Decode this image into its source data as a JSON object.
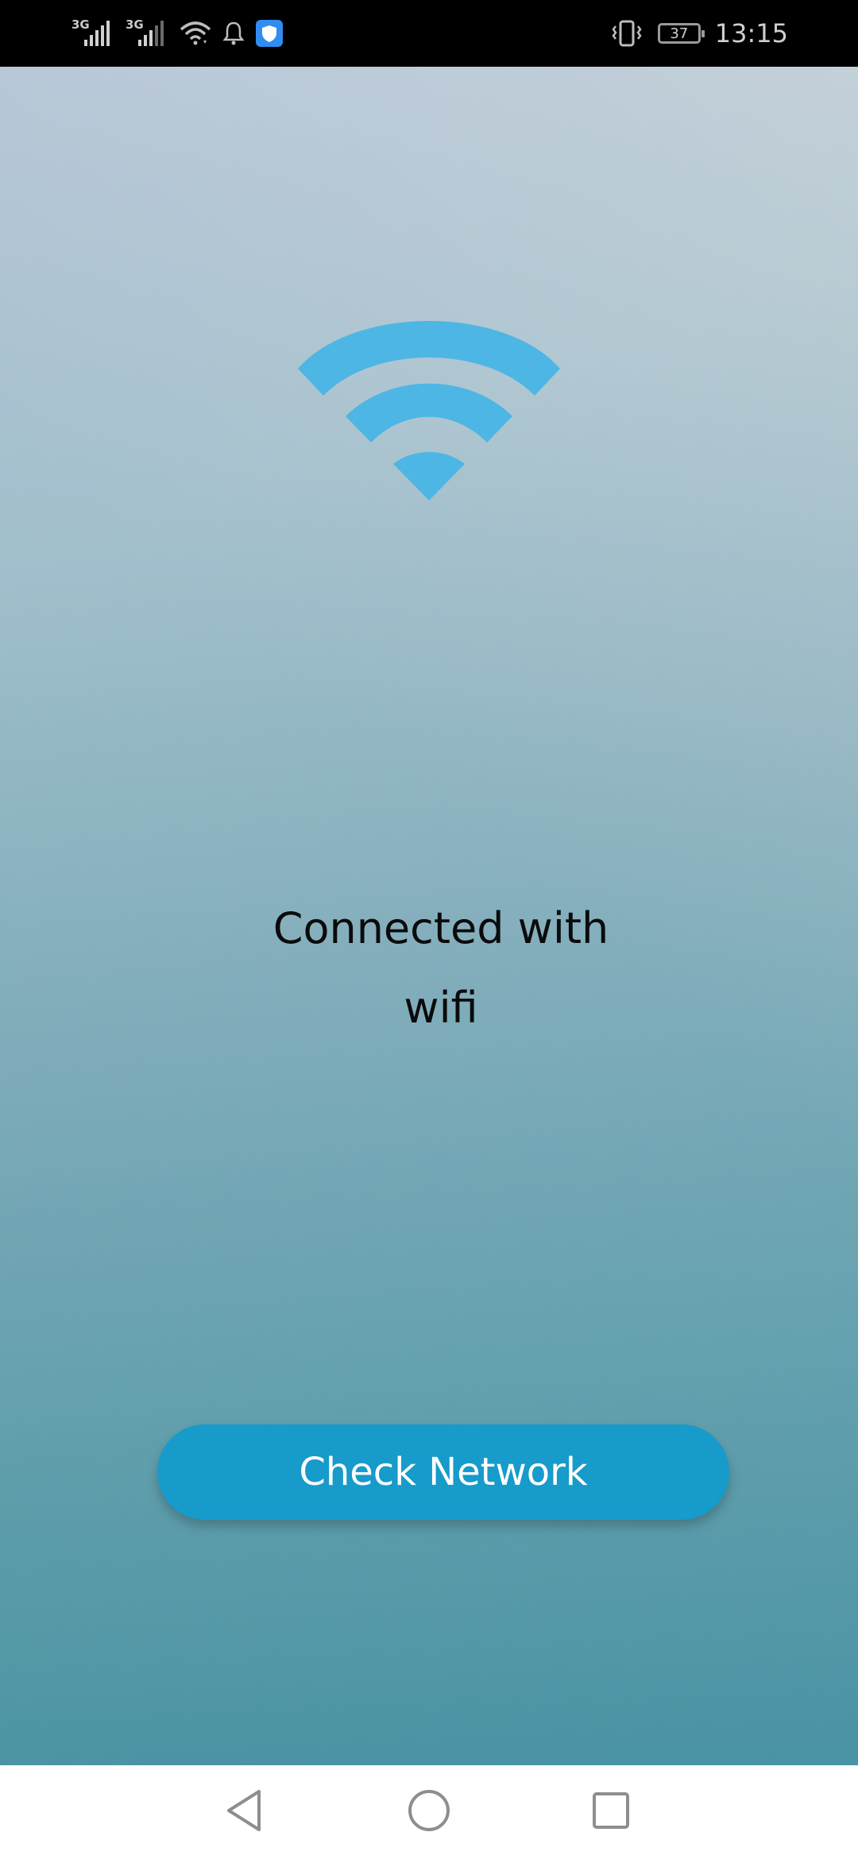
{
  "status_bar": {
    "sim1_network": "3G",
    "sim2_network": "3G",
    "battery_level": "37",
    "time": "13:15",
    "icons": [
      "signal-icon",
      "signal-icon",
      "wifi-icon",
      "bell-icon",
      "shield-app-icon",
      "vibrate-icon",
      "battery-icon"
    ]
  },
  "main": {
    "status_line1": "Connected with",
    "status_line2": "wifi",
    "check_button_label": "Check Network",
    "hero_icon": "wifi-icon"
  },
  "nav_bar": {
    "icons": [
      "back-icon",
      "home-icon",
      "recents-icon"
    ]
  },
  "colors": {
    "button": "#169bcb",
    "wifi_icon": "#4db6e4",
    "status_bar_bg": "#000000",
    "nav_bar_bg": "#ffffff"
  }
}
